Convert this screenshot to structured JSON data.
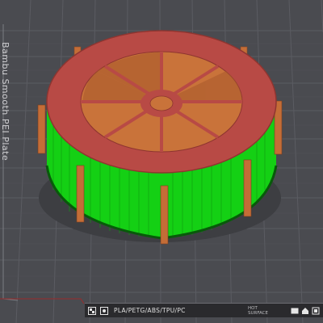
{
  "plate": {
    "label": "Bambu Smooth PEI Plate"
  },
  "bottom_bar": {
    "filament_types": "PLA/PETG/ABS/TPU/PC",
    "surface_line1": "HOT",
    "surface_line2": "SURFACE",
    "icons": [
      "plate-icon",
      "settings-icon",
      "home-icon",
      "view-icon"
    ]
  },
  "model": {
    "colors": {
      "rim": "#b84a45",
      "wall": "#14d014",
      "interior": "#c9733a",
      "spoke": "#c6733a",
      "fins": "#c46d37",
      "bed": "#4a4b50",
      "grid": "#5a5b61"
    }
  }
}
